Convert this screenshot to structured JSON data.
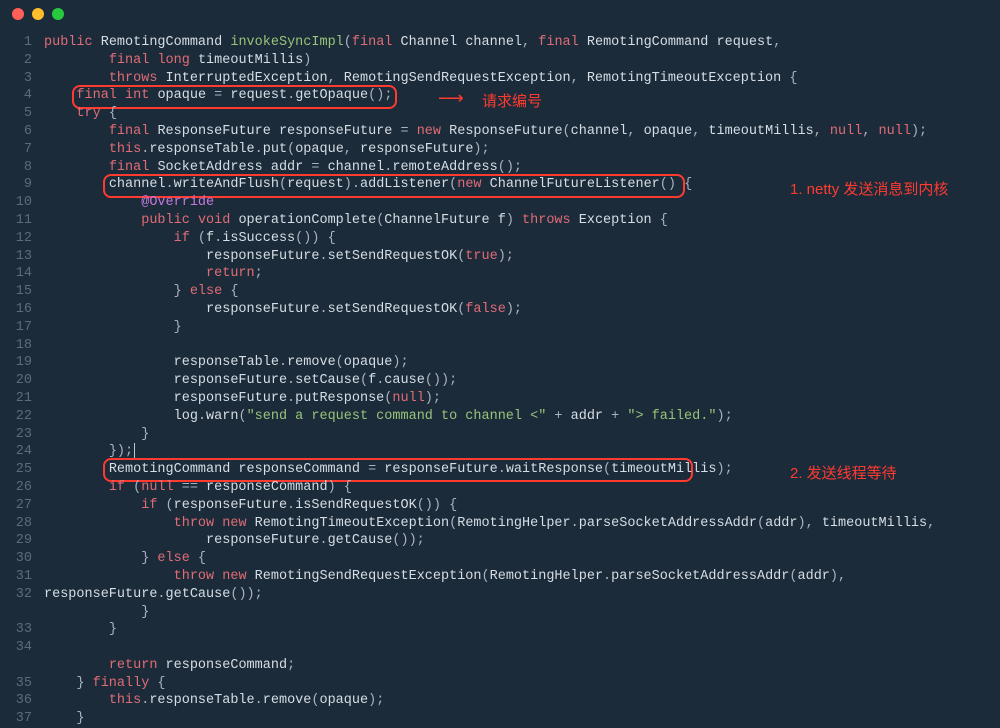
{
  "titlebar": {
    "buttons": [
      "close",
      "minimize",
      "zoom"
    ]
  },
  "annotations": {
    "a1": "请求编号",
    "a2": "1. netty 发送消息到内核",
    "a3": "2. 发送线程等待"
  },
  "code": {
    "lines": [
      {
        "n": 1,
        "tokens": [
          [
            "kw",
            "public"
          ],
          [
            "sp",
            " "
          ],
          [
            "id",
            "RemotingCommand"
          ],
          [
            "sp",
            " "
          ],
          [
            "call",
            "invokeSyncImpl"
          ],
          [
            "punc",
            "("
          ],
          [
            "kw",
            "final"
          ],
          [
            "sp",
            " "
          ],
          [
            "id",
            "Channel channel"
          ],
          [
            "punc",
            ", "
          ],
          [
            "kw",
            "final"
          ],
          [
            "sp",
            " "
          ],
          [
            "id",
            "RemotingCommand request"
          ],
          [
            "punc",
            ","
          ]
        ]
      },
      {
        "n": 2,
        "indent": 8,
        "tokens": [
          [
            "kw",
            "final"
          ],
          [
            "sp",
            " "
          ],
          [
            "kw",
            "long"
          ],
          [
            "sp",
            " "
          ],
          [
            "id",
            "timeoutMillis"
          ],
          [
            "punc",
            ")"
          ]
        ]
      },
      {
        "n": 3,
        "indent": 8,
        "tokens": [
          [
            "kw",
            "throws"
          ],
          [
            "sp",
            " "
          ],
          [
            "id",
            "InterruptedException"
          ],
          [
            "punc",
            ", "
          ],
          [
            "id",
            "RemotingSendRequestException"
          ],
          [
            "punc",
            ", "
          ],
          [
            "id",
            "RemotingTimeoutException"
          ],
          [
            "punc",
            " {"
          ]
        ]
      },
      {
        "n": 4,
        "indent": 4,
        "tokens": [
          [
            "kw",
            "final"
          ],
          [
            "sp",
            " "
          ],
          [
            "kw",
            "int"
          ],
          [
            "sp",
            " "
          ],
          [
            "id",
            "opaque"
          ],
          [
            "punc",
            " = "
          ],
          [
            "id",
            "request"
          ],
          [
            "punc",
            "."
          ],
          [
            "id",
            "getOpaque"
          ],
          [
            "punc",
            "();"
          ]
        ]
      },
      {
        "n": 5,
        "indent": 4,
        "tokens": [
          [
            "kw",
            "try"
          ],
          [
            "punc",
            " {"
          ]
        ]
      },
      {
        "n": 6,
        "indent": 8,
        "tokens": [
          [
            "kw",
            "final"
          ],
          [
            "sp",
            " "
          ],
          [
            "id",
            "ResponseFuture responseFuture"
          ],
          [
            "punc",
            " = "
          ],
          [
            "kw",
            "new"
          ],
          [
            "sp",
            " "
          ],
          [
            "id",
            "ResponseFuture"
          ],
          [
            "punc",
            "("
          ],
          [
            "id",
            "channel"
          ],
          [
            "punc",
            ", "
          ],
          [
            "id",
            "opaque"
          ],
          [
            "punc",
            ", "
          ],
          [
            "id",
            "timeoutMillis"
          ],
          [
            "punc",
            ", "
          ],
          [
            "bool",
            "null"
          ],
          [
            "punc",
            ", "
          ],
          [
            "bool",
            "null"
          ],
          [
            "punc",
            ");"
          ]
        ]
      },
      {
        "n": 7,
        "indent": 8,
        "tokens": [
          [
            "kw",
            "this"
          ],
          [
            "punc",
            "."
          ],
          [
            "id",
            "responseTable"
          ],
          [
            "punc",
            "."
          ],
          [
            "id",
            "put"
          ],
          [
            "punc",
            "("
          ],
          [
            "id",
            "opaque"
          ],
          [
            "punc",
            ", "
          ],
          [
            "id",
            "responseFuture"
          ],
          [
            "punc",
            ");"
          ]
        ]
      },
      {
        "n": 8,
        "indent": 8,
        "tokens": [
          [
            "kw",
            "final"
          ],
          [
            "sp",
            " "
          ],
          [
            "id",
            "SocketAddress addr"
          ],
          [
            "punc",
            " = "
          ],
          [
            "id",
            "channel"
          ],
          [
            "punc",
            "."
          ],
          [
            "id",
            "remoteAddress"
          ],
          [
            "punc",
            "();"
          ]
        ]
      },
      {
        "n": 9,
        "indent": 8,
        "tokens": [
          [
            "id",
            "channel"
          ],
          [
            "punc",
            "."
          ],
          [
            "id",
            "writeAndFlush"
          ],
          [
            "punc",
            "("
          ],
          [
            "id",
            "request"
          ],
          [
            "punc",
            ")."
          ],
          [
            "id",
            "addListener"
          ],
          [
            "punc",
            "("
          ],
          [
            "kw",
            "new"
          ],
          [
            "sp",
            " "
          ],
          [
            "id",
            "ChannelFutureListener"
          ],
          [
            "punc",
            "() {"
          ]
        ]
      },
      {
        "n": 10,
        "indent": 12,
        "tokens": [
          [
            "anno",
            "@Override"
          ]
        ]
      },
      {
        "n": 11,
        "indent": 12,
        "tokens": [
          [
            "kw",
            "public"
          ],
          [
            "sp",
            " "
          ],
          [
            "kw",
            "void"
          ],
          [
            "sp",
            " "
          ],
          [
            "id",
            "operationComplete"
          ],
          [
            "punc",
            "("
          ],
          [
            "id",
            "ChannelFuture f"
          ],
          [
            "punc",
            ") "
          ],
          [
            "kw",
            "throws"
          ],
          [
            "sp",
            " "
          ],
          [
            "id",
            "Exception"
          ],
          [
            "punc",
            " {"
          ]
        ]
      },
      {
        "n": 12,
        "indent": 16,
        "tokens": [
          [
            "kw",
            "if"
          ],
          [
            "punc",
            " ("
          ],
          [
            "id",
            "f"
          ],
          [
            "punc",
            "."
          ],
          [
            "id",
            "isSuccess"
          ],
          [
            "punc",
            "()) {"
          ]
        ]
      },
      {
        "n": 13,
        "indent": 20,
        "tokens": [
          [
            "id",
            "responseFuture"
          ],
          [
            "punc",
            "."
          ],
          [
            "id",
            "setSendRequestOK"
          ],
          [
            "punc",
            "("
          ],
          [
            "bool",
            "true"
          ],
          [
            "punc",
            ");"
          ]
        ]
      },
      {
        "n": 14,
        "indent": 20,
        "tokens": [
          [
            "kw",
            "return"
          ],
          [
            "punc",
            ";"
          ]
        ]
      },
      {
        "n": 15,
        "indent": 16,
        "tokens": [
          [
            "punc",
            "} "
          ],
          [
            "kw",
            "else"
          ],
          [
            "punc",
            " {"
          ]
        ]
      },
      {
        "n": 16,
        "indent": 20,
        "tokens": [
          [
            "id",
            "responseFuture"
          ],
          [
            "punc",
            "."
          ],
          [
            "id",
            "setSendRequestOK"
          ],
          [
            "punc",
            "("
          ],
          [
            "bool",
            "false"
          ],
          [
            "punc",
            ");"
          ]
        ]
      },
      {
        "n": 17,
        "indent": 16,
        "tokens": [
          [
            "punc",
            "}"
          ]
        ]
      },
      {
        "n": 18,
        "indent": 0,
        "tokens": []
      },
      {
        "n": 19,
        "indent": 16,
        "tokens": [
          [
            "id",
            "responseTable"
          ],
          [
            "punc",
            "."
          ],
          [
            "id",
            "remove"
          ],
          [
            "punc",
            "("
          ],
          [
            "id",
            "opaque"
          ],
          [
            "punc",
            ");"
          ]
        ]
      },
      {
        "n": 20,
        "indent": 16,
        "tokens": [
          [
            "id",
            "responseFuture"
          ],
          [
            "punc",
            "."
          ],
          [
            "id",
            "setCause"
          ],
          [
            "punc",
            "("
          ],
          [
            "id",
            "f"
          ],
          [
            "punc",
            "."
          ],
          [
            "id",
            "cause"
          ],
          [
            "punc",
            "());"
          ]
        ]
      },
      {
        "n": 21,
        "indent": 16,
        "tokens": [
          [
            "id",
            "responseFuture"
          ],
          [
            "punc",
            "."
          ],
          [
            "id",
            "putResponse"
          ],
          [
            "punc",
            "("
          ],
          [
            "bool",
            "null"
          ],
          [
            "punc",
            ");"
          ]
        ]
      },
      {
        "n": 22,
        "indent": 16,
        "tokens": [
          [
            "id",
            "log"
          ],
          [
            "punc",
            "."
          ],
          [
            "id",
            "warn"
          ],
          [
            "punc",
            "("
          ],
          [
            "str",
            "\"send a request command to channel <\""
          ],
          [
            "punc",
            " + "
          ],
          [
            "id",
            "addr"
          ],
          [
            "punc",
            " + "
          ],
          [
            "str",
            "\"> failed.\""
          ],
          [
            "punc",
            ");"
          ]
        ]
      },
      {
        "n": 23,
        "indent": 12,
        "tokens": [
          [
            "punc",
            "}"
          ]
        ]
      },
      {
        "n": 24,
        "indent": 8,
        "tokens": [
          [
            "punc",
            "});"
          ],
          [
            "cursor",
            ""
          ]
        ]
      },
      {
        "n": 25,
        "indent": 8,
        "tokens": [
          [
            "id",
            "RemotingCommand responseCommand"
          ],
          [
            "punc",
            " = "
          ],
          [
            "id",
            "responseFuture"
          ],
          [
            "punc",
            "."
          ],
          [
            "id",
            "waitResponse"
          ],
          [
            "punc",
            "("
          ],
          [
            "id",
            "timeoutMillis"
          ],
          [
            "punc",
            ");"
          ]
        ]
      },
      {
        "n": 26,
        "indent": 8,
        "tokens": [
          [
            "kw",
            "if"
          ],
          [
            "punc",
            " ("
          ],
          [
            "bool",
            "null"
          ],
          [
            "punc",
            " == "
          ],
          [
            "id",
            "responseCommand"
          ],
          [
            "punc",
            ") {"
          ]
        ]
      },
      {
        "n": 27,
        "indent": 12,
        "tokens": [
          [
            "kw",
            "if"
          ],
          [
            "punc",
            " ("
          ],
          [
            "id",
            "responseFuture"
          ],
          [
            "punc",
            "."
          ],
          [
            "id",
            "isSendRequestOK"
          ],
          [
            "punc",
            "()) {"
          ]
        ]
      },
      {
        "n": 28,
        "indent": 16,
        "tokens": [
          [
            "kw",
            "throw"
          ],
          [
            "sp",
            " "
          ],
          [
            "kw",
            "new"
          ],
          [
            "sp",
            " "
          ],
          [
            "id",
            "RemotingTimeoutException"
          ],
          [
            "punc",
            "("
          ],
          [
            "id",
            "RemotingHelper"
          ],
          [
            "punc",
            "."
          ],
          [
            "id",
            "parseSocketAddressAddr"
          ],
          [
            "punc",
            "("
          ],
          [
            "id",
            "addr"
          ],
          [
            "punc",
            "), "
          ],
          [
            "id",
            "timeoutMillis"
          ],
          [
            "punc",
            ","
          ]
        ]
      },
      {
        "n": 29,
        "indent": 20,
        "tokens": [
          [
            "id",
            "responseFuture"
          ],
          [
            "punc",
            "."
          ],
          [
            "id",
            "getCause"
          ],
          [
            "punc",
            "());"
          ]
        ]
      },
      {
        "n": 30,
        "indent": 12,
        "tokens": [
          [
            "punc",
            "} "
          ],
          [
            "kw",
            "else"
          ],
          [
            "punc",
            " {"
          ]
        ]
      },
      {
        "n": 31,
        "indent": 16,
        "tokens": [
          [
            "kw",
            "throw"
          ],
          [
            "sp",
            " "
          ],
          [
            "kw",
            "new"
          ],
          [
            "sp",
            " "
          ],
          [
            "id",
            "RemotingSendRequestException"
          ],
          [
            "punc",
            "("
          ],
          [
            "id",
            "RemotingHelper"
          ],
          [
            "punc",
            "."
          ],
          [
            "id",
            "parseSocketAddressAddr"
          ],
          [
            "punc",
            "("
          ],
          [
            "id",
            "addr"
          ],
          [
            "punc",
            "),"
          ]
        ]
      },
      {
        "n": 32,
        "indent2": true,
        "tokens": [
          [
            "id",
            "responseFuture"
          ],
          [
            "punc",
            "."
          ],
          [
            "id",
            "getCause"
          ],
          [
            "punc",
            "());"
          ]
        ]
      },
      {
        "n": 32,
        "sub": true,
        "indent": 12,
        "tokens": [
          [
            "punc",
            "}"
          ]
        ]
      },
      {
        "n": 33,
        "indent": 8,
        "tokens": [
          [
            "punc",
            "}"
          ]
        ]
      },
      {
        "n": 34,
        "indent": 0,
        "tokens": []
      },
      {
        "n": 34,
        "sub": true,
        "indent": 8,
        "tokens": [
          [
            "kw",
            "return"
          ],
          [
            "sp",
            " "
          ],
          [
            "id",
            "responseCommand"
          ],
          [
            "punc",
            ";"
          ]
        ]
      },
      {
        "n": 35,
        "indent": 4,
        "tokens": [
          [
            "punc",
            "} "
          ],
          [
            "kw",
            "finally"
          ],
          [
            "punc",
            " {"
          ]
        ]
      },
      {
        "n": 36,
        "indent": 8,
        "tokens": [
          [
            "kw",
            "this"
          ],
          [
            "punc",
            "."
          ],
          [
            "id",
            "responseTable"
          ],
          [
            "punc",
            "."
          ],
          [
            "id",
            "remove"
          ],
          [
            "punc",
            "("
          ],
          [
            "id",
            "opaque"
          ],
          [
            "punc",
            ");"
          ]
        ]
      },
      {
        "n": 37,
        "indent": 4,
        "tokens": [
          [
            "punc",
            "}"
          ]
        ]
      }
    ]
  }
}
